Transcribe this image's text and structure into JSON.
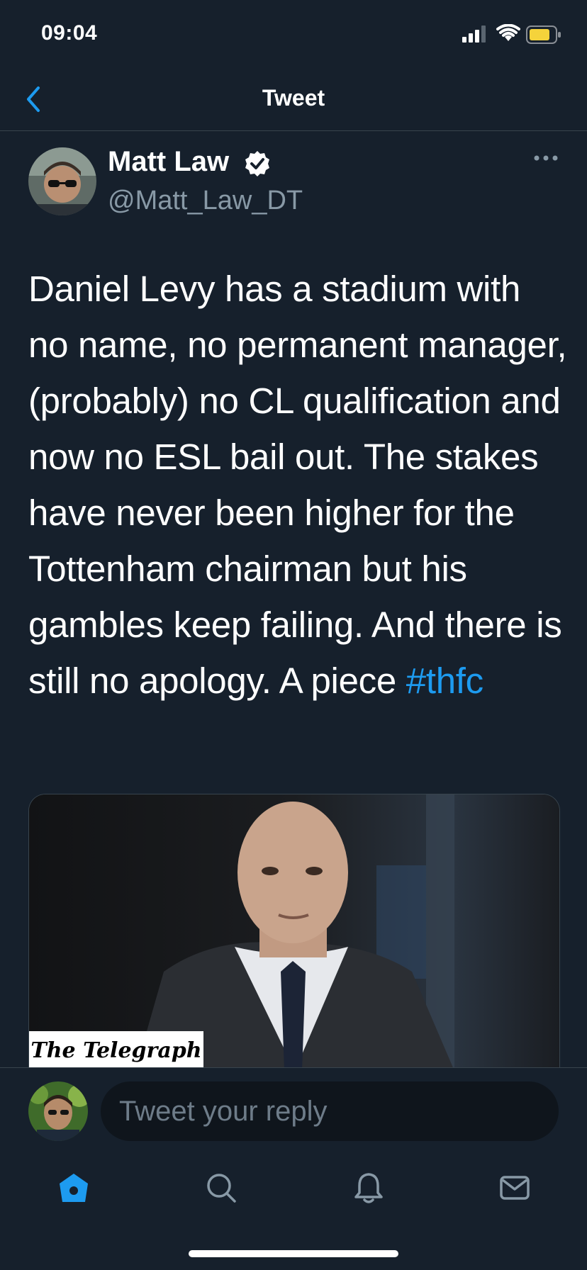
{
  "status_bar": {
    "time": "09:04"
  },
  "nav": {
    "title": "Tweet"
  },
  "tweet": {
    "author_name": "Matt Law",
    "author_handle": "@Matt_Law_DT",
    "text": "Daniel Levy has a stadium with no name, no permanent manager, (probably) no CL qualification and now no ESL bail out. The stakes have never been higher for the Tottenham chairman but his gambles keep failing. And there is still no apology. A piece ",
    "hashtag": "#thfc",
    "card_source": "The Telegraph"
  },
  "reply": {
    "placeholder": "Tweet your reply"
  },
  "tabs": [
    "home-icon",
    "search-icon",
    "notifications-icon",
    "messages-icon"
  ],
  "colors": {
    "background": "#16202c",
    "accent": "#1d9bf0",
    "secondary_text": "#8899a6"
  }
}
